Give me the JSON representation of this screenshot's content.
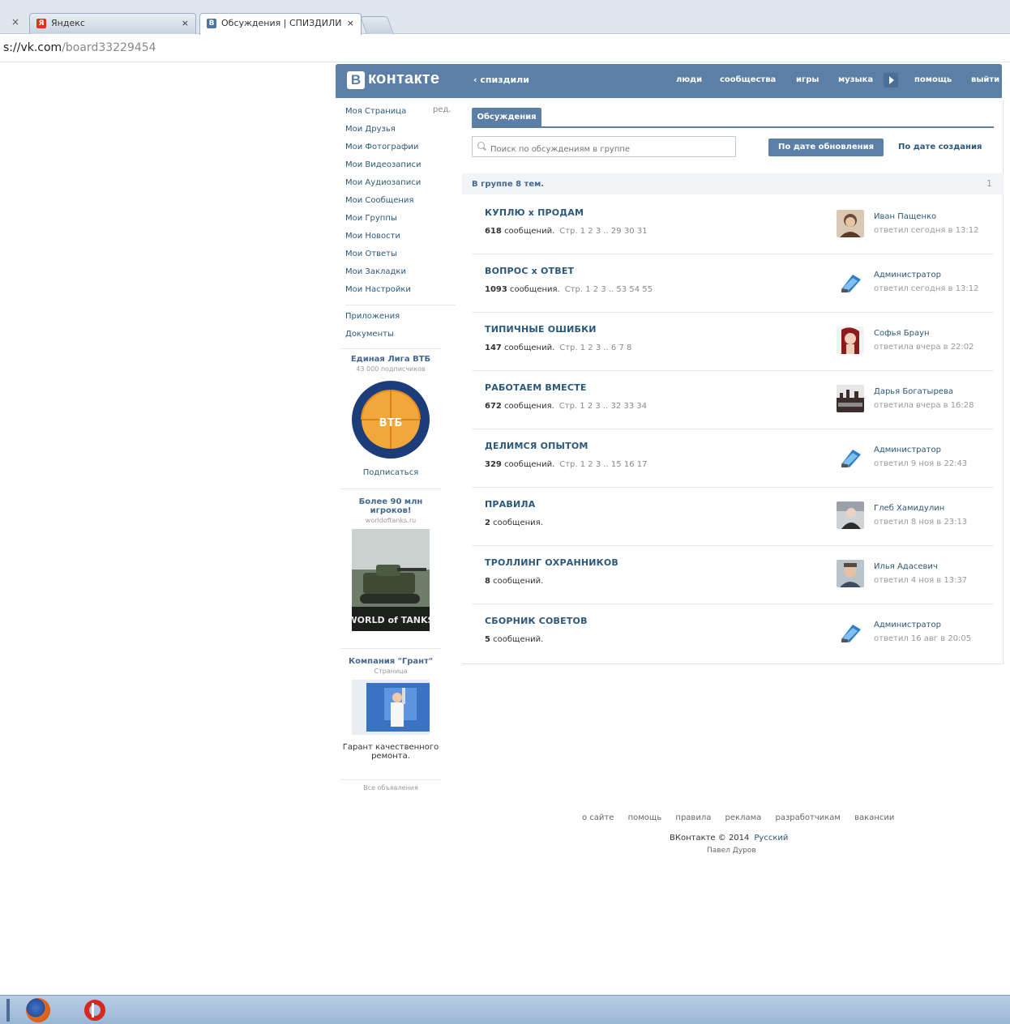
{
  "browser": {
    "tabs": [
      {
        "label": "Яндекс",
        "close": "×",
        "favicon": "Я",
        "favicon_color": "#e3301c"
      },
      {
        "label": "Обсуждения | СПИЗДИЛИ",
        "close": "×",
        "favicon": "В",
        "favicon_color": "#4e739c"
      }
    ],
    "window_close": "×",
    "url_host": "s://vk.com",
    "url_path": "/board33229454"
  },
  "header": {
    "logo_letter": "В",
    "logo_text": "контакте",
    "group_link": "‹ спиздили",
    "nav": [
      "люди",
      "сообщества",
      "игры",
      "музыка",
      "помощь",
      "выйти"
    ],
    "accent": "#5b7fa6"
  },
  "left_menu": {
    "edit_label": "ред.",
    "items": [
      "Моя Страница",
      "Мои Друзья",
      "Мои Фотографии",
      "Мои Видеозаписи",
      "Мои Аудиозаписи",
      "Мои Сообщения",
      "Мои Группы",
      "Мои Новости",
      "Мои Ответы",
      "Мои Закладки",
      "Мои Настройки"
    ],
    "extra_items": [
      "Приложения",
      "Документы"
    ]
  },
  "ads": [
    {
      "title": "Единая Лига ВТБ",
      "subtitle": "43 000 подписчиков",
      "action": "Подписаться",
      "image_icon": "vtb-league-logo",
      "logo_text": "ВТБ"
    },
    {
      "title": "Более 90 млн игроков!",
      "subtitle": "worldoftanks.ru",
      "image_icon": "world-of-tanks-banner",
      "banner_text": "WORLD of TANKS"
    },
    {
      "title": "Компания \"Грант\"",
      "subtitle": "Страница",
      "image_icon": "renovation-photo",
      "description": "Гарант качественного ремонта."
    }
  ],
  "ads_all_label": "Все объявления",
  "discussions": {
    "tab_label": "Обсуждения",
    "search_placeholder": "Поиск по обсуждениям в группе",
    "sort_by_update": "По дате обновления",
    "sort_by_created": "По дате создания",
    "summary": "В группе 8 тем.",
    "pager": "1",
    "topics": [
      {
        "title": "КУПЛЮ x ПРОДАМ",
        "count": "618",
        "count_suffix": "сообщений.",
        "pages": "Стр. 1  2  3 .. 29  30  31",
        "author": "Иван Пащенко",
        "time": "ответил сегодня в 13:12",
        "avatar": "user-avatar-photo"
      },
      {
        "title": "ВОПРОС x ОТВЕТ",
        "count": "1093",
        "count_suffix": "сообщения.",
        "pages": "Стр. 1  2  3 .. 53  54  55",
        "author": "Администратор",
        "time": "ответил сегодня в 13:12",
        "avatar": "admin-avatar"
      },
      {
        "title": "ТИПИЧНЫЕ ОШИБКИ",
        "count": "147",
        "count_suffix": "сообщений.",
        "pages": "Стр. 1  2  3 .. 6  7  8",
        "author": "Софья Браун",
        "time": "ответила вчера в 22:02",
        "avatar": "user-avatar-photo"
      },
      {
        "title": "РАБОТАЕМ ВМЕСТЕ",
        "count": "672",
        "count_suffix": "сообщения.",
        "pages": "Стр. 1  2  3 .. 32  33  34",
        "author": "Дарья Богатырева",
        "time": "ответила вчера в 16:28",
        "avatar": "user-avatar-photo"
      },
      {
        "title": "ДЕЛИМСЯ ОПЫТОМ",
        "count": "329",
        "count_suffix": "сообщений.",
        "pages": "Стр. 1  2  3 .. 15  16  17",
        "author": "Администратор",
        "time": "ответил 9 ноя в 22:43",
        "avatar": "admin-avatar"
      },
      {
        "title": "ПРАВИЛА",
        "count": "2",
        "count_suffix": "сообщения.",
        "pages": "",
        "author": "Глеб Хамидулин",
        "time": "ответил 8 ноя в 23:13",
        "avatar": "user-avatar-photo"
      },
      {
        "title": "ТРОЛЛИНГ ОХРАННИКОВ",
        "count": "8",
        "count_suffix": "сообщений.",
        "pages": "",
        "author": "Илья Адасевич",
        "time": "ответил 4 ноя в 13:37",
        "avatar": "user-avatar-photo"
      },
      {
        "title": "СБОРНИК СОВЕТОВ",
        "count": "5",
        "count_suffix": "сообщений.",
        "pages": "",
        "author": "Администратор",
        "time": "ответил 16 авг в 20:05",
        "avatar": "admin-avatar"
      }
    ]
  },
  "footer": {
    "links": [
      "о сайте",
      "помощь",
      "правила",
      "реклама",
      "разработчикам",
      "вакансии"
    ],
    "copyright": "ВКонтакте © 2014",
    "language": "Русский",
    "author": "Павел Дуров"
  },
  "taskbar": {
    "apps": [
      "firefox-icon",
      "opera-icon"
    ]
  }
}
